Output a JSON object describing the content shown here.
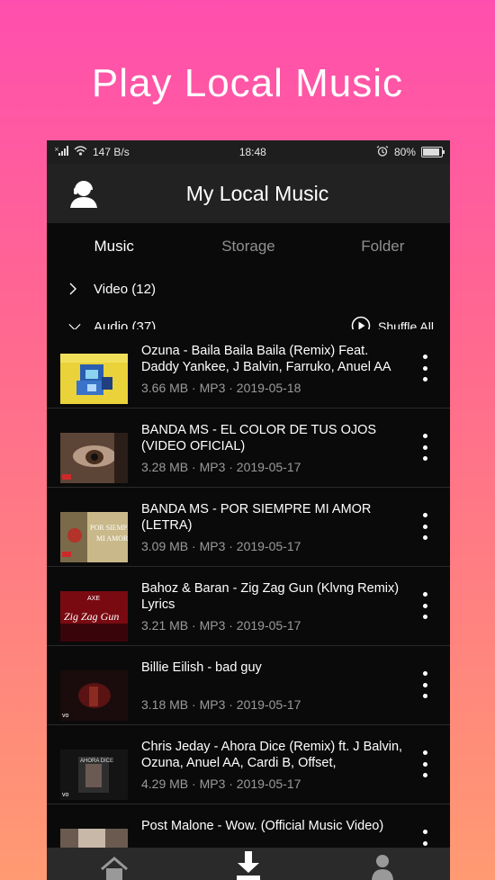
{
  "promo_title": "Play Local Music",
  "status": {
    "speed": "147 B/s",
    "time": "18:48",
    "battery": "80%",
    "battery_level": 0.8
  },
  "appbar": {
    "title": "My Local Music",
    "avatar_icon": "user-headset-icon"
  },
  "tabs": [
    {
      "label": "Music",
      "active": true
    },
    {
      "label": "Storage",
      "active": false
    },
    {
      "label": "Folder",
      "active": false
    }
  ],
  "groups": {
    "video": {
      "label": "Video (12)",
      "expanded": false
    },
    "audio": {
      "label": "Audio (37)",
      "expanded": true,
      "shuffle_label": "Shuffle All"
    }
  },
  "items": [
    {
      "title": "Ozuna - Baila Baila Baila (Remix) Feat. Daddy Yankee, J Balvin, Farruko, Anuel AA",
      "size": "3.66 MB",
      "format": "MP3",
      "date": "2019-05-18",
      "meta": "3.66 MB · MP3 · 2019-05-18"
    },
    {
      "title": "BANDA MS - EL COLOR DE TUS OJOS (VIDEO OFICIAL)",
      "size": "3.28 MB",
      "format": "MP3",
      "date": "2019-05-17",
      "meta": "3.28 MB · MP3 · 2019-05-17"
    },
    {
      "title": "BANDA MS - POR SIEMPRE MI AMOR (LETRA)",
      "size": "3.09 MB",
      "format": "MP3",
      "date": "2019-05-17",
      "meta": "3.09 MB · MP3 · 2019-05-17"
    },
    {
      "title": "Bahoz & Baran - Zig Zag Gun (Klvng Remix) Lyrics",
      "size": "3.21 MB",
      "format": "MP3",
      "date": "2019-05-17",
      "meta": "3.21 MB · MP3 · 2019-05-17"
    },
    {
      "title": "Billie Eilish - bad guy",
      "size": "3.18 MB",
      "format": "MP3",
      "date": "2019-05-17",
      "meta": "3.18 MB · MP3 · 2019-05-17"
    },
    {
      "title": "Chris Jeday - Ahora Dice (Remix) ft. J Balvin, Ozuna, Anuel AA, Cardi B, Offset,",
      "size": "4.29 MB",
      "format": "MP3",
      "date": "2019-05-17",
      "meta": "4.29 MB · MP3 · 2019-05-17"
    },
    {
      "title": "Post Malone - Wow. (Official Music Video)",
      "size": "",
      "format": "",
      "date": "",
      "meta": ""
    }
  ],
  "thumb_text": {
    "item3": "POR SIEMPRE MI AMOR",
    "item4_top": "AXE",
    "item4": "Zig Zag Gun",
    "item6": "AHORA DICE",
    "vevo": "vo"
  },
  "bottom_nav": [
    {
      "icon": "home-icon"
    },
    {
      "icon": "download-icon"
    },
    {
      "icon": "profile-icon"
    }
  ],
  "colors": {
    "gradient_top": "#ff4fae",
    "gradient_bottom": "#ff9a72",
    "panel": "#0a0a0a",
    "appbar": "#222222"
  }
}
